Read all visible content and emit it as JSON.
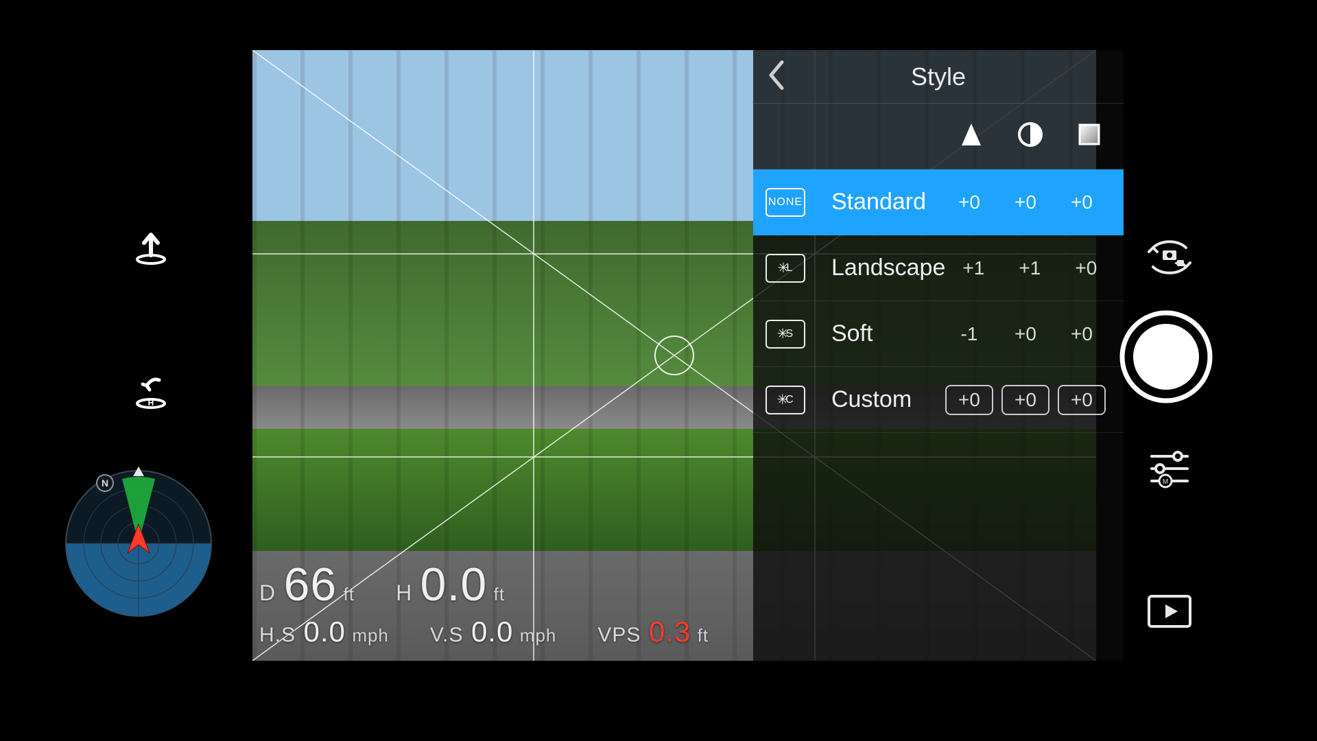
{
  "panel": {
    "title": "Style",
    "header_icons": [
      "sharpness-icon",
      "contrast-icon",
      "saturation-icon"
    ],
    "styles": [
      {
        "badge": "NONE",
        "name": "Standard",
        "sharp": "+0",
        "contrast": "+0",
        "sat": "+0",
        "selected": true,
        "boxed": false
      },
      {
        "badge": "L",
        "name": "Landscape",
        "sharp": "+1",
        "contrast": "+1",
        "sat": "+0",
        "selected": false,
        "boxed": false
      },
      {
        "badge": "S",
        "name": "Soft",
        "sharp": "-1",
        "contrast": "+0",
        "sat": "+0",
        "selected": false,
        "boxed": false
      },
      {
        "badge": "C",
        "name": "Custom",
        "sharp": "+0",
        "contrast": "+0",
        "sat": "+0",
        "selected": false,
        "boxed": true
      }
    ]
  },
  "telemetry": {
    "d": {
      "label": "D",
      "value": "66",
      "unit": "ft"
    },
    "h": {
      "label": "H",
      "value": "0.0",
      "unit": "ft"
    },
    "hs": {
      "label": "H.S",
      "value": "0.0",
      "unit": "mph"
    },
    "vs": {
      "label": "V.S",
      "value": "0.0",
      "unit": "mph"
    },
    "vps": {
      "label": "VPS",
      "value": "0.3",
      "unit": "ft"
    }
  },
  "radar": {
    "north_label": "N"
  },
  "colors": {
    "accent": "#1ea3ff",
    "alert": "#ff3b30"
  }
}
